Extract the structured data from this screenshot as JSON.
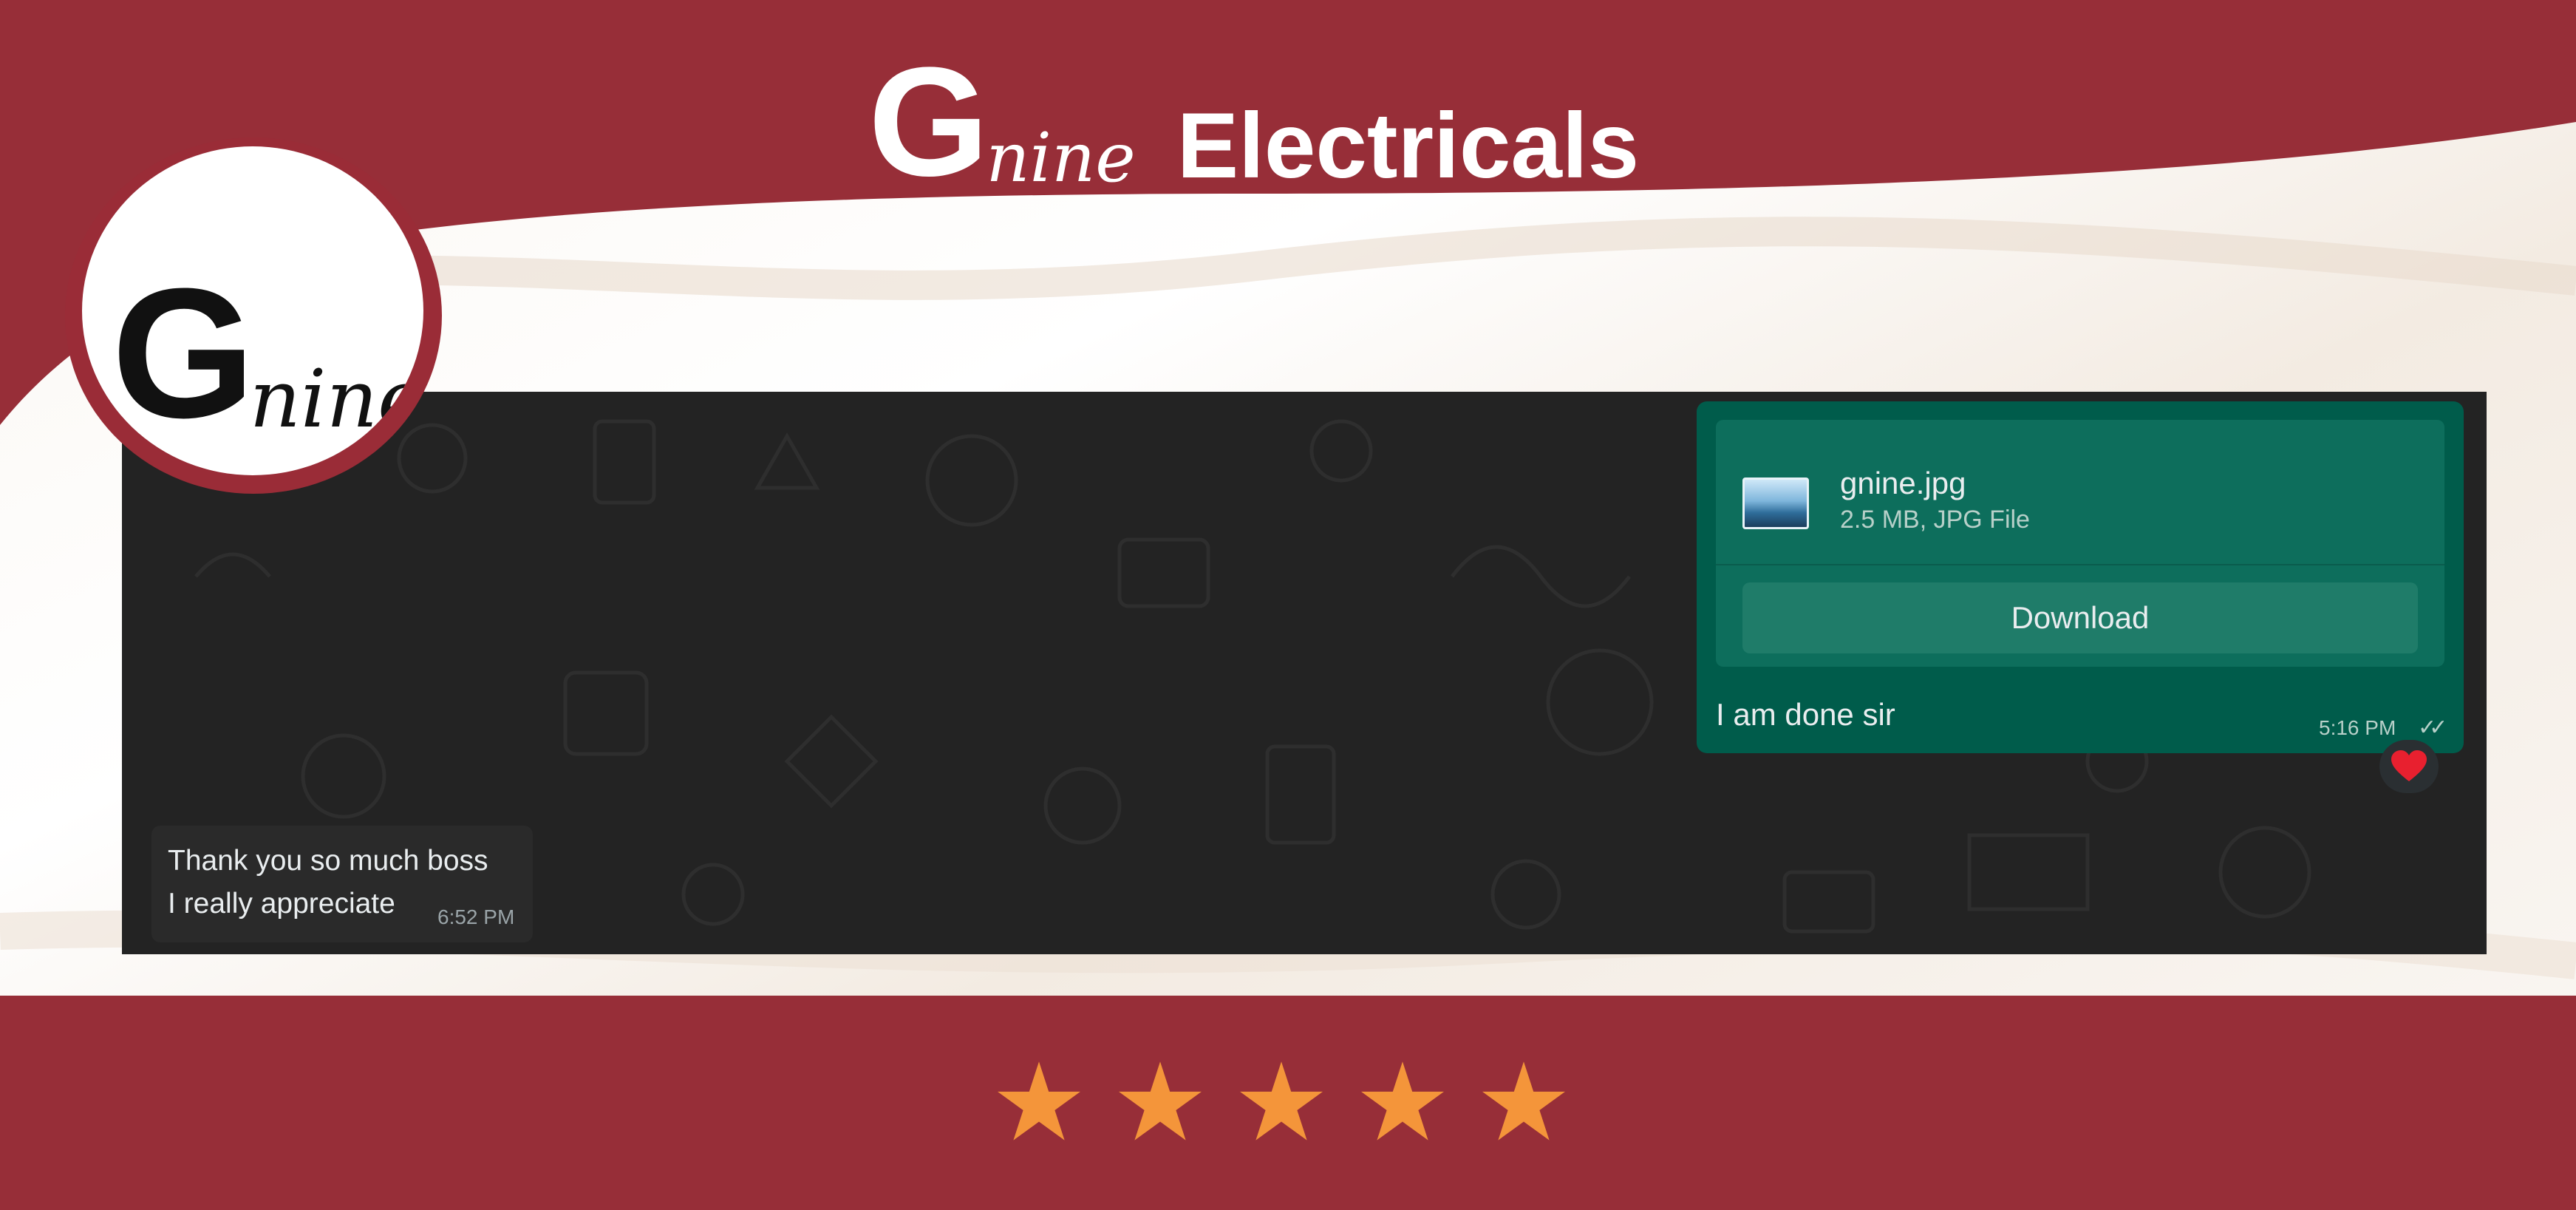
{
  "brand": {
    "title_initial": "G",
    "title_suffix": "nine",
    "title_word": "Electricals",
    "logo_initial": "G",
    "logo_suffix": "nine",
    "colors": {
      "maroon": "#972e38",
      "chat_bg": "#232323",
      "outgoing": "#005c4b",
      "star": "#f4953a"
    }
  },
  "chat": {
    "outgoing": {
      "file_name": "gnine.jpg",
      "file_meta": "2.5 MB, JPG File",
      "download_label": "Download",
      "text": "I am done sir",
      "time": "5:16 PM",
      "status_icon": "double-check-icon",
      "reaction": "❤️"
    },
    "incoming": {
      "line1": "Thank you so much boss",
      "line2": "I really appreciate",
      "time": "6:52 PM"
    }
  },
  "rating": {
    "stars": 5,
    "max": 5
  }
}
